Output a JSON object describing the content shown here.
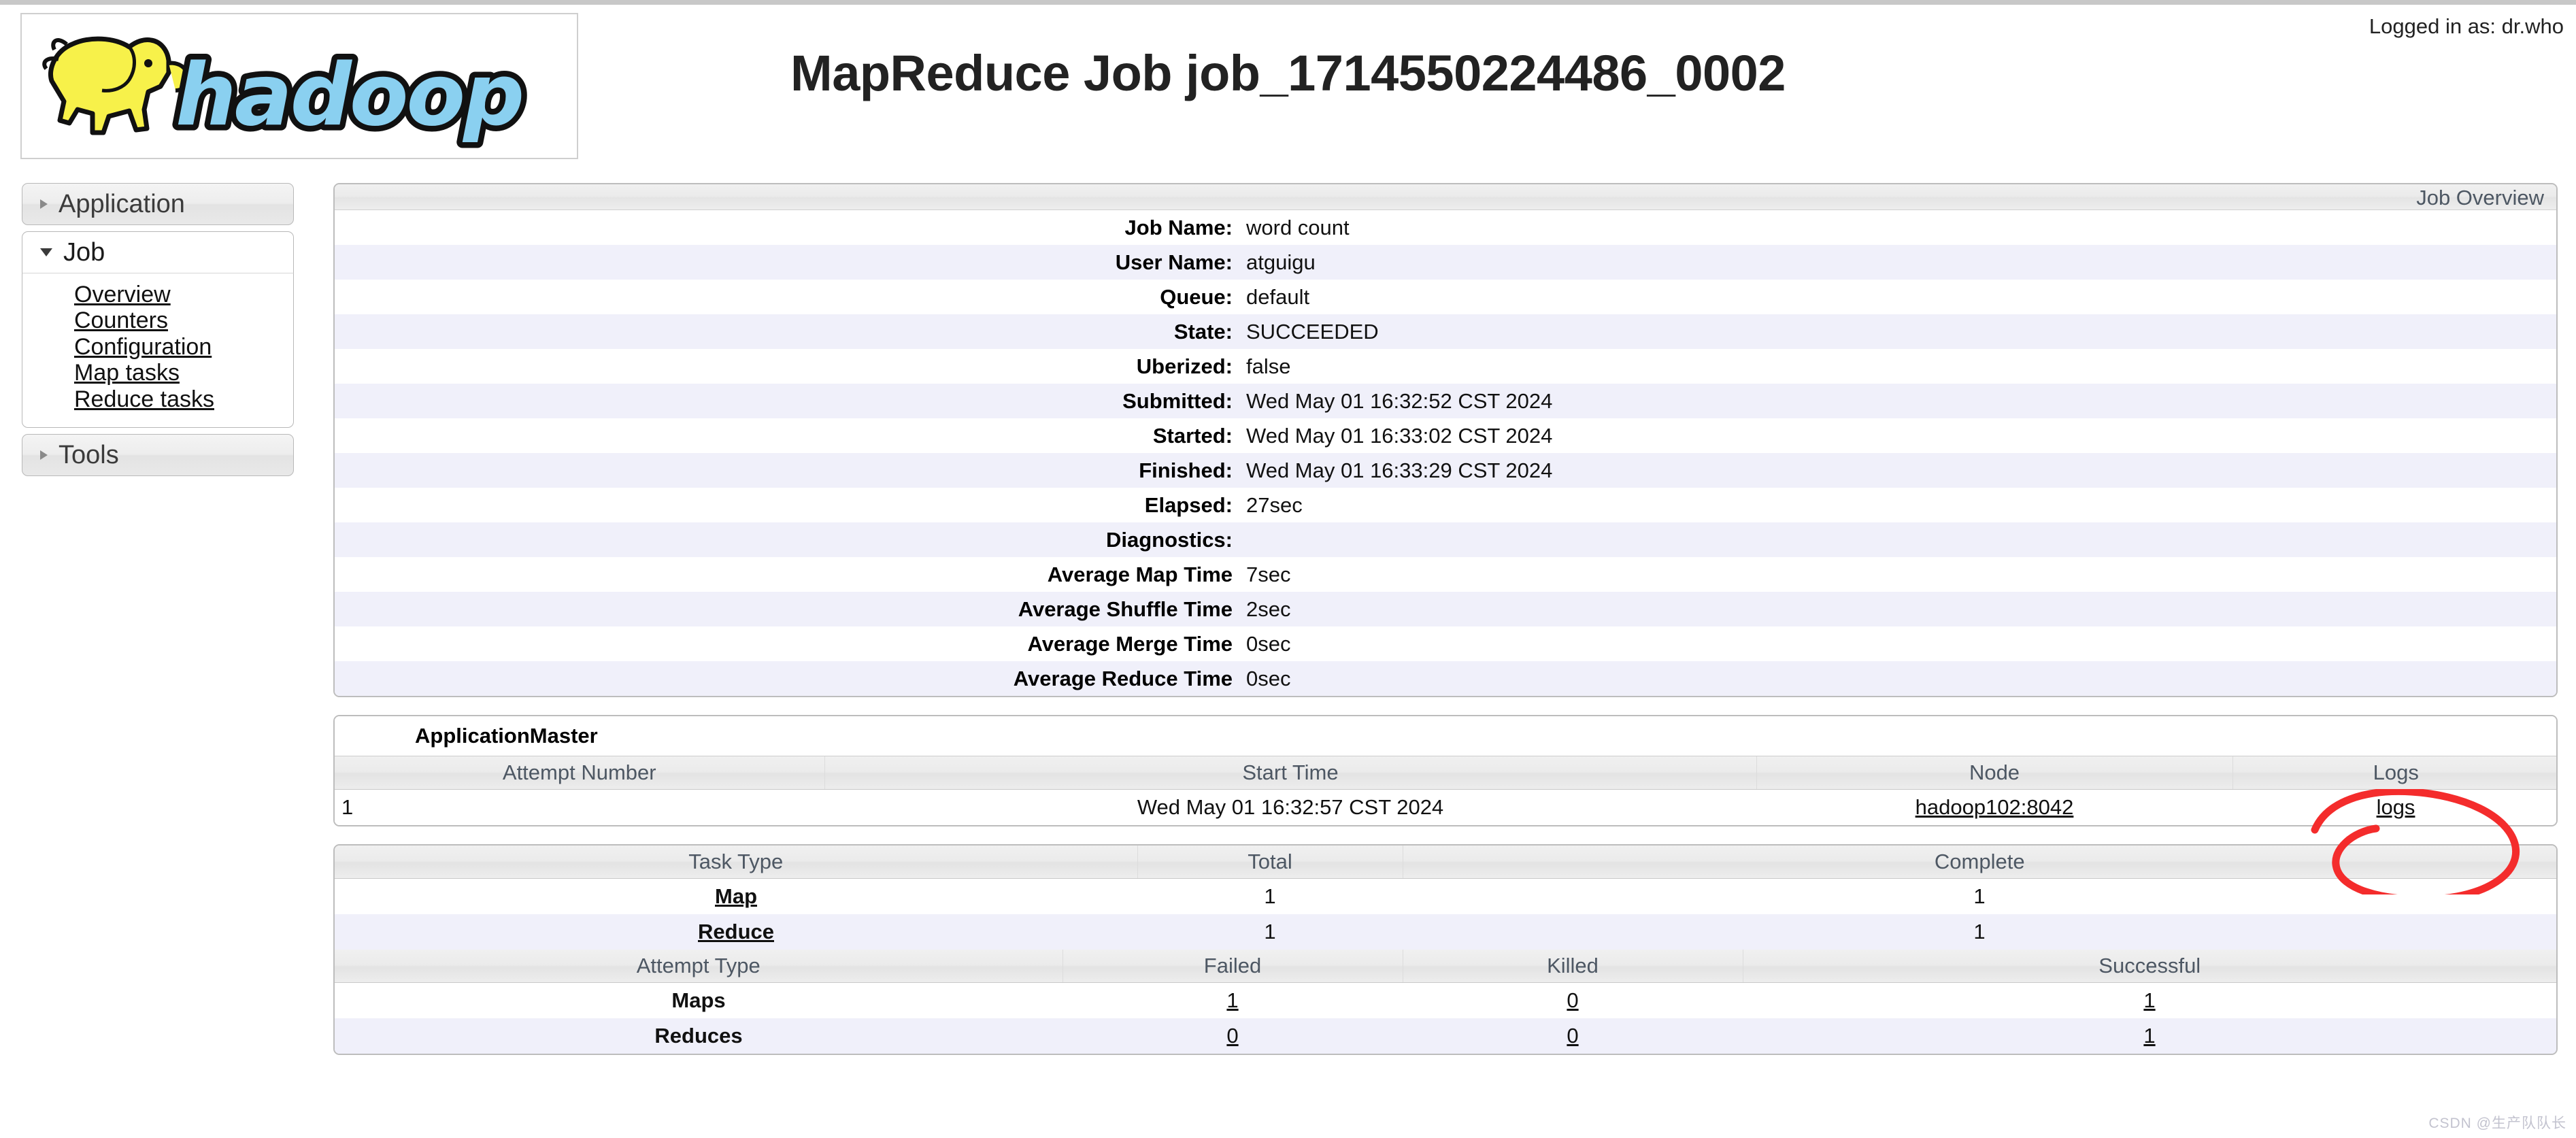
{
  "header": {
    "logo_alt": "hadoop-logo",
    "title": "MapReduce Job job_1714550224486_0002",
    "logged_in": "Logged in as: dr.who"
  },
  "sidebar": {
    "sections": [
      {
        "label": "Application",
        "expanded": false,
        "items": []
      },
      {
        "label": "Job",
        "expanded": true,
        "items": [
          "Overview",
          "Counters",
          "Configuration",
          "Map tasks",
          "Reduce tasks"
        ]
      },
      {
        "label": "Tools",
        "expanded": false,
        "items": []
      }
    ]
  },
  "job_overview": {
    "caption": "Job Overview",
    "rows": [
      {
        "key": "Job Name:",
        "value": "word count"
      },
      {
        "key": "User Name:",
        "value": "atguigu"
      },
      {
        "key": "Queue:",
        "value": "default"
      },
      {
        "key": "State:",
        "value": "SUCCEEDED"
      },
      {
        "key": "Uberized:",
        "value": "false"
      },
      {
        "key": "Submitted:",
        "value": "Wed May 01 16:32:52 CST 2024"
      },
      {
        "key": "Started:",
        "value": "Wed May 01 16:33:02 CST 2024"
      },
      {
        "key": "Finished:",
        "value": "Wed May 01 16:33:29 CST 2024"
      },
      {
        "key": "Elapsed:",
        "value": "27sec"
      },
      {
        "key": "Diagnostics:",
        "value": ""
      },
      {
        "key": "Average Map Time",
        "value": "7sec"
      },
      {
        "key": "Average Shuffle Time",
        "value": "2sec"
      },
      {
        "key": "Average Merge Time",
        "value": "0sec"
      },
      {
        "key": "Average Reduce Time",
        "value": "0sec"
      }
    ]
  },
  "application_master": {
    "title": "ApplicationMaster",
    "columns": [
      "Attempt Number",
      "Start Time",
      "Node",
      "Logs"
    ],
    "rows": [
      {
        "attempt": "1",
        "start_time": "Wed May 01 16:32:57 CST 2024",
        "node": "hadoop102:8042",
        "logs": "logs"
      }
    ]
  },
  "task_summary": {
    "columns": [
      "Task Type",
      "Total",
      "Complete"
    ],
    "rows": [
      {
        "type": "Map",
        "total": "1",
        "complete": "1"
      },
      {
        "type": "Reduce",
        "total": "1",
        "complete": "1"
      }
    ]
  },
  "attempt_summary": {
    "columns": [
      "Attempt Type",
      "Failed",
      "Killed",
      "Successful"
    ],
    "rows": [
      {
        "type": "Maps",
        "failed": "1",
        "killed": "0",
        "successful": "1"
      },
      {
        "type": "Reduces",
        "failed": "0",
        "killed": "0",
        "successful": "1"
      }
    ]
  },
  "annotation": {
    "shape": "red-circle",
    "target": "logs",
    "color": "#f42c2c"
  },
  "watermark": "CSDN @生产队队长"
}
